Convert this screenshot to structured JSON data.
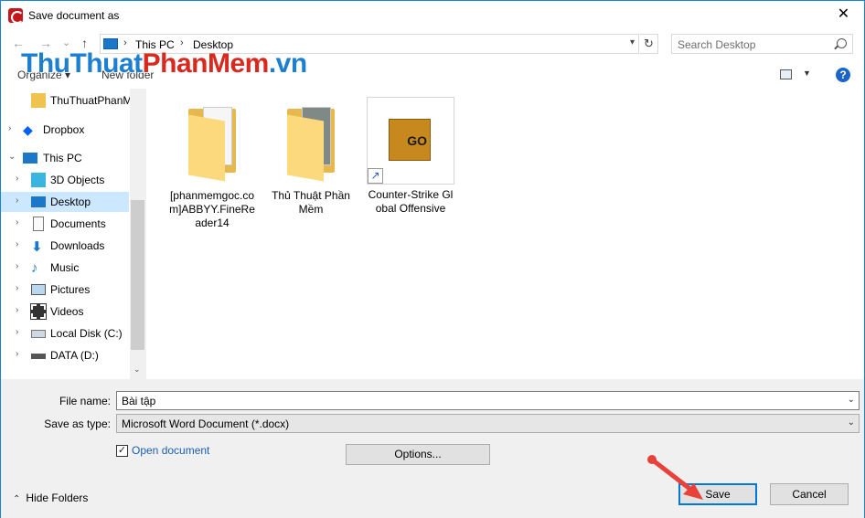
{
  "window": {
    "title": "Save document as"
  },
  "nav": {
    "back": "←",
    "forward": "→",
    "recent": "⌄",
    "up": "↑",
    "path": [
      "This PC",
      "Desktop"
    ],
    "search_placeholder": "Search Desktop"
  },
  "watermark": {
    "part1": "ThuThuat",
    "part2": "PhanMem",
    "part3": ".vn"
  },
  "toolbar": {
    "organize": "Organize ▾",
    "new_folder": "New folder"
  },
  "sidebar": {
    "items": [
      {
        "label": "ThuThuatPhanM",
        "icon": "folder-icon"
      },
      {
        "label": "Dropbox",
        "icon": "dropbox-icon"
      },
      {
        "label": "This PC",
        "icon": "computer-icon"
      },
      {
        "label": "3D Objects",
        "icon": "cube-icon"
      },
      {
        "label": "Desktop",
        "icon": "desktop-icon"
      },
      {
        "label": "Documents",
        "icon": "documents-icon"
      },
      {
        "label": "Downloads",
        "icon": "download-icon"
      },
      {
        "label": "Music",
        "icon": "music-icon"
      },
      {
        "label": "Pictures",
        "icon": "pictures-icon"
      },
      {
        "label": "Videos",
        "icon": "videos-icon"
      },
      {
        "label": "Local Disk (C:)",
        "icon": "disk-icon"
      },
      {
        "label": "DATA (D:)",
        "icon": "drive-icon"
      }
    ]
  },
  "files": [
    {
      "label": "[phanmemgoc.com]ABBYY.FineReader14",
      "type": "folder"
    },
    {
      "label": "Thủ Thuật Phần Mềm",
      "type": "folder-image"
    },
    {
      "label": "Counter-Strike Global Offensive",
      "type": "shortcut",
      "icon_text": "GO"
    }
  ],
  "form": {
    "file_name_label": "File name:",
    "file_name_value": "Bài tập",
    "save_type_label": "Save as type:",
    "save_type_value": "Microsoft Word Document (*.docx)",
    "open_document_label": "Open document",
    "open_document_checked": true,
    "options_label": "Options..."
  },
  "footer": {
    "hide_folders": "Hide Folders",
    "save": "Save",
    "cancel": "Cancel"
  },
  "colors": {
    "accent": "#0078d7",
    "selected": "#cce8ff",
    "annotation": "#e8413a"
  }
}
